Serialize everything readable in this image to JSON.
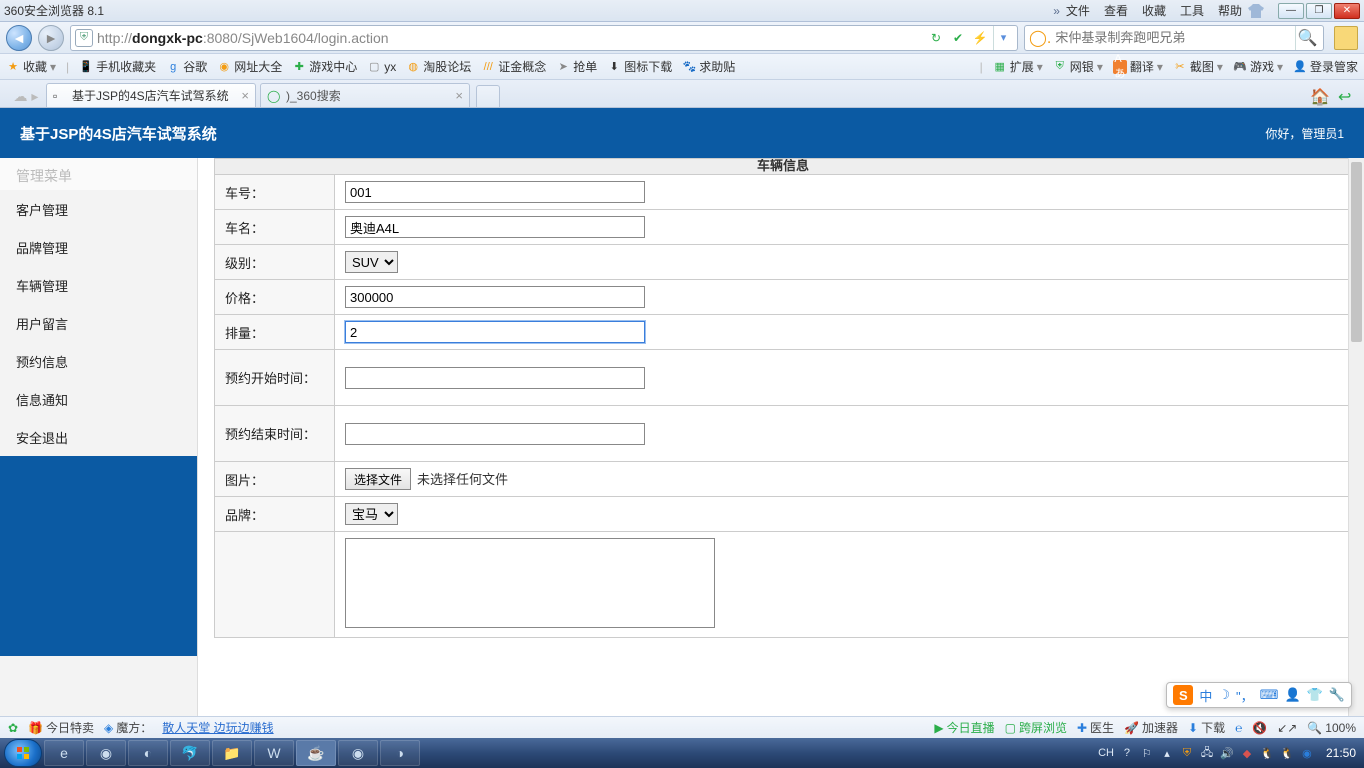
{
  "titlebar": {
    "app_title": "360安全浏览器 8.1",
    "menus": [
      "文件",
      "查看",
      "收藏",
      "工具",
      "帮助"
    ]
  },
  "addr": {
    "url_prefix": "http://",
    "url_host": "dongxk-pc",
    "url_rest": ":8080/SjWeb1604/login.action",
    "search_placeholder": "宋仲基录制奔跑吧兄弟"
  },
  "bookmarks": {
    "fav": "收藏",
    "items": [
      "手机收藏夹",
      "谷歌",
      "网址大全",
      "游戏中心",
      "yx",
      "淘股论坛",
      "证金概念",
      "抢单",
      "图标下载",
      "求助贴"
    ],
    "right": [
      "扩展",
      "网银",
      "翻译",
      "截图",
      "游戏",
      "登录管家"
    ]
  },
  "tabs": {
    "t1": "基于JSP的4S店汽车试驾系统",
    "t2": ")_360搜索"
  },
  "header": {
    "title": "基于JSP的4S店汽车试驾系统",
    "welcome": "你好，管理员1"
  },
  "sidebar": {
    "title": "管理菜单",
    "items": [
      "客户管理",
      "品牌管理",
      "车辆管理",
      "用户留言",
      "预约信息",
      "信息通知",
      "安全退出"
    ]
  },
  "form": {
    "section_title": "车辆信息",
    "labels": {
      "no": "车号：",
      "name": "车名：",
      "level": "级别：",
      "price": "价格：",
      "disp": "排量：",
      "start": "预约开始时间：",
      "end": "预约结束时间：",
      "photo": "图片：",
      "brand": "品牌："
    },
    "values": {
      "no": "001",
      "name": "奥迪A4L",
      "level": "SUV",
      "price": "300000",
      "disp": "2",
      "start": "",
      "end": "",
      "file_btn": "选择文件",
      "file_text": "未选择任何文件",
      "brand": "宝马"
    }
  },
  "pgbar": {
    "today": "今日特卖",
    "mofang": "魔方：",
    "links": "散人天堂 边玩边赚钱",
    "right": [
      "今日直播",
      "跨屏浏览",
      "医生",
      "加速器",
      "下载",
      "℮",
      "ⓘ"
    ],
    "zoom": "100%"
  },
  "tray": {
    "ch": "CH",
    "clock": "21:50"
  },
  "ime": {
    "zhong": "中"
  }
}
